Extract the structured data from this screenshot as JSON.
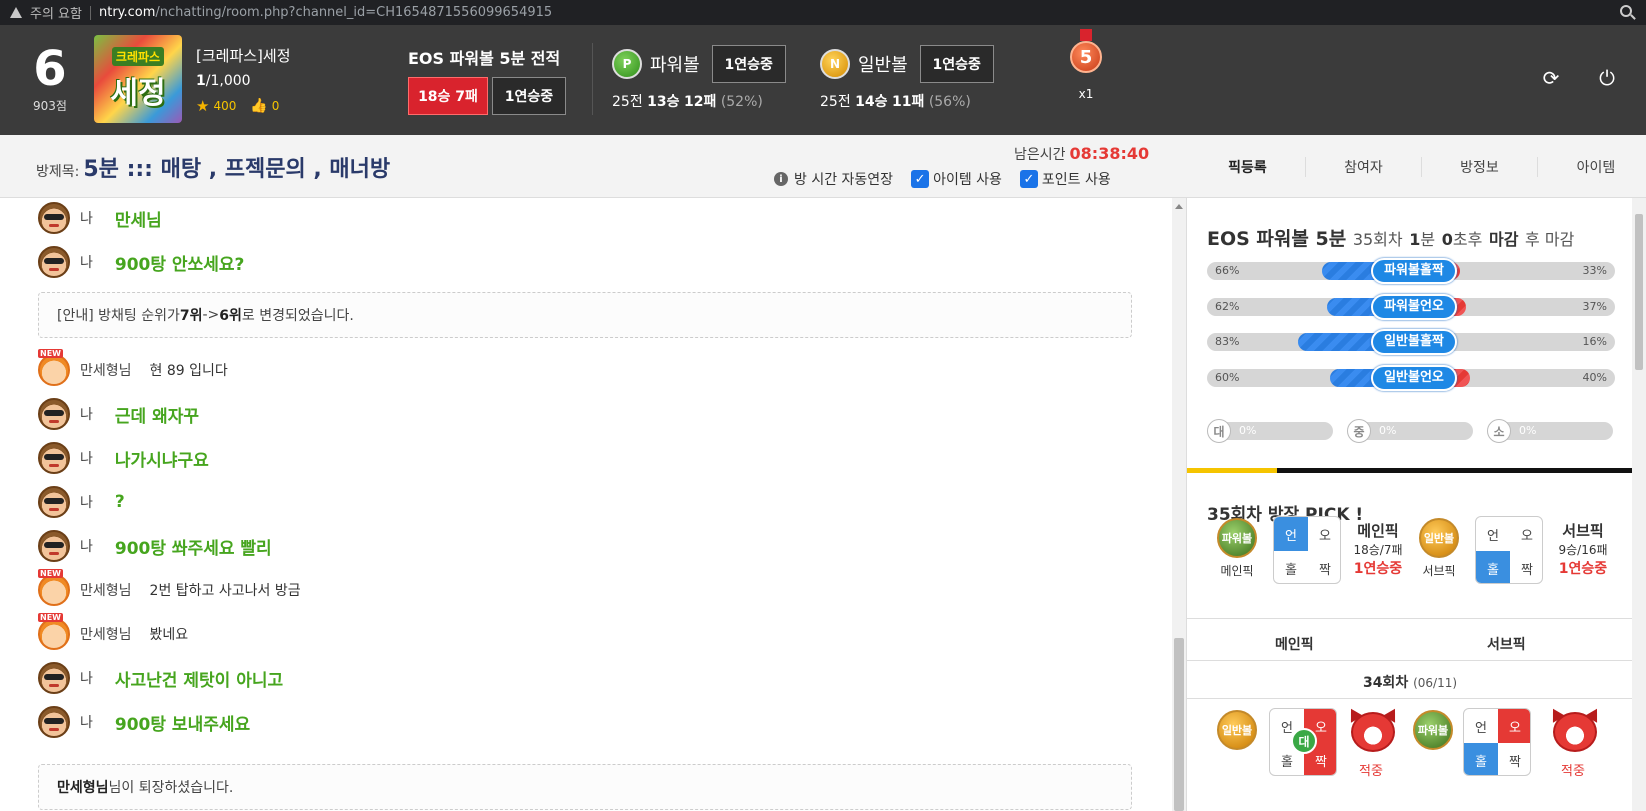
{
  "browser": {
    "warning": "주의 요함",
    "host": "ntry.com",
    "path": "/nchatting/room.php?channel_id=CH1654871556099654915"
  },
  "header": {
    "level": "6",
    "points": "903점",
    "avatar_line1": "크레파스",
    "avatar_line2": "세정",
    "nickname": "[크레파스]세정",
    "rank_current": "1",
    "rank_total": "/1,000",
    "stars": "400",
    "likes": "0",
    "eos_title": "EOS 파워볼 5분 전적",
    "eos_record": "18승 7패",
    "eos_streak": "1연승중",
    "powerball": {
      "icon": "P",
      "name": "파워볼",
      "streak": "1연승중",
      "games": "25전",
      "wins": "13승",
      "losses": "12패",
      "pct": "(52%)"
    },
    "normalball": {
      "icon": "N",
      "name": "일반볼",
      "streak": "1연승중",
      "games": "25전",
      "wins": "14승",
      "losses": "11패",
      "pct": "(56%)"
    },
    "medal_num": "5",
    "medal_mult": "x1"
  },
  "subbar": {
    "room_label": "방제목:",
    "room_title": "5분 ::: 매탕 , 프젝문의 , 매너방",
    "remain_label": "남은시간",
    "remain_time": "08:38:40",
    "auto_extend": "방 시간 자동연장",
    "item_use": "아이템 사용",
    "point_use": "포인트 사용",
    "tabs": [
      "픽등록",
      "참여자",
      "방정보",
      "아이템"
    ]
  },
  "chat": {
    "me": "나",
    "other": "만세형님",
    "m1": "만세님",
    "m2": "900탕 안쏘세요?",
    "notice1_pre": "[안내] 방채팅 순위가 ",
    "notice1_a": "7위",
    "notice1_mid": " -> ",
    "notice1_b": "6위",
    "notice1_post": " 로 변경되었습니다.",
    "m3": "현 89 입니다",
    "m4": "근데 왜자꾸",
    "m5": "나가시냐구요",
    "m6": "?",
    "m7": "900탕 쏴주세요 빨리",
    "m8": "2번 탑하고 사고나서 방금",
    "m9": "봤네요",
    "m10": "사고난건 제탓이 아니고",
    "m11": "900탕 보내주세요",
    "notice2_name": "만세형님",
    "notice2_post": "님이 퇴장하셨습니다."
  },
  "panel": {
    "title": "EOS 파워볼 5분",
    "round": "35회차",
    "deadline_a": "1",
    "deadline_a_unit": "분",
    "deadline_b": "0",
    "deadline_b_unit": "초후",
    "deadline_c": "마감",
    "deadline_d": "후 마감",
    "bars": [
      {
        "label": "파워볼홀짝",
        "left": "66%",
        "right": "33%",
        "left_v": 66,
        "right_v": 33
      },
      {
        "label": "파워볼언오",
        "left": "62%",
        "right": "37%",
        "left_v": 62,
        "right_v": 37
      },
      {
        "label": "일반볼홀짝",
        "left": "83%",
        "right": "16%",
        "left_v": 83,
        "right_v": 16
      },
      {
        "label": "일반볼언오",
        "left": "60%",
        "right": "40%",
        "left_v": 60,
        "right_v": 40
      }
    ],
    "sizes": [
      {
        "icon": "대",
        "pct": "0%"
      },
      {
        "icon": "중",
        "pct": "0%"
      },
      {
        "icon": "소",
        "pct": "0%"
      }
    ],
    "pick_title": "35회차 방장 PICK !",
    "ball_power": "파워볼",
    "ball_normal": "일반볼",
    "main_label": "메인픽",
    "sub_label": "서브픽",
    "cell_under": "언",
    "cell_over": "오",
    "cell_odd": "홀",
    "cell_even": "짝",
    "main_title": "메인픽",
    "main_record": "18승/7패",
    "main_streak": "1연승중",
    "sub_title": "서브픽",
    "sub_record": "9승/16패",
    "sub_streak": "1연승중",
    "col_main": "메인픽",
    "col_sub": "서브픽",
    "prev_round": "34회차",
    "prev_date": "(06/11)",
    "dae": "대",
    "hit": "적중"
  }
}
